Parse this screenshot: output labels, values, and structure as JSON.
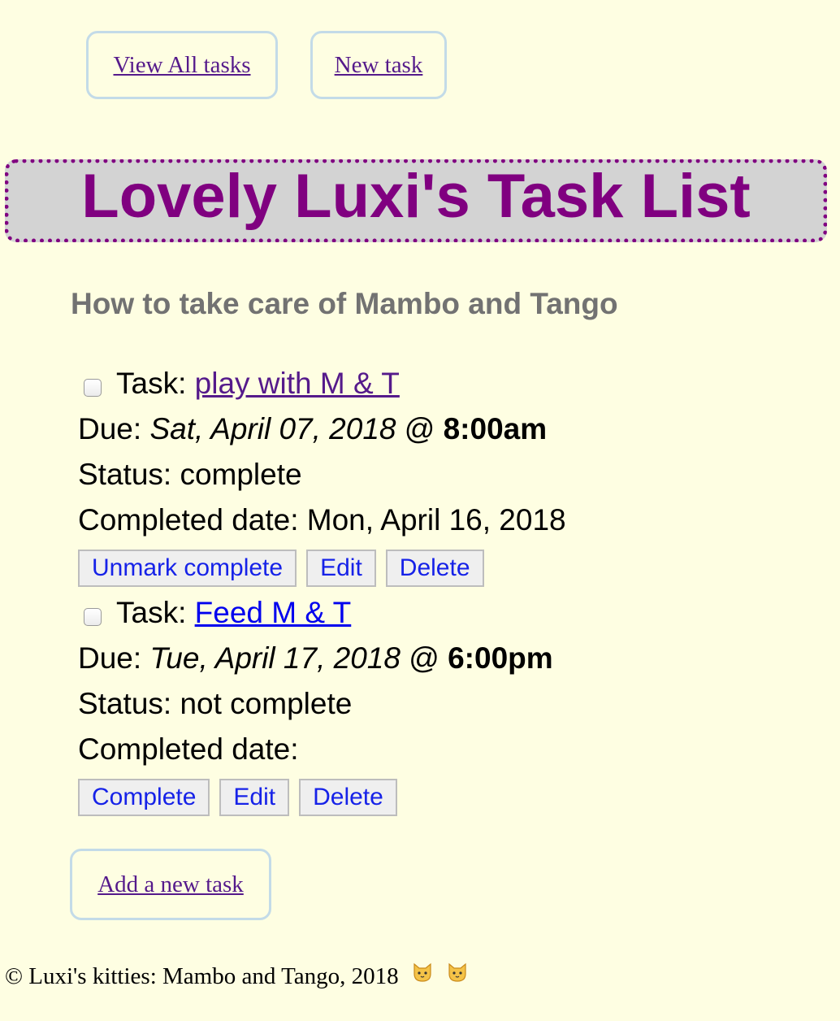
{
  "nav": {
    "view_all": "View All tasks",
    "new_task": "New task"
  },
  "title": "Lovely Luxi's Task List",
  "subtitle": "How to take care of Mambo and Tango",
  "tasks": [
    {
      "task_label": "Task:",
      "name": "play with M & T",
      "due_label": "Due:",
      "due_date": "Sat, April 07, 2018",
      "at": "@",
      "due_time": "8:00am",
      "status_text": "Status: complete",
      "completed_text": "Completed date: Mon, April 16, 2018",
      "actions": {
        "toggle": "Unmark complete",
        "edit": "Edit",
        "delete": "Delete"
      }
    },
    {
      "task_label": "Task:",
      "name": "Feed M & T",
      "due_label": "Due:",
      "due_date": "Tue, April 17, 2018",
      "at": "@",
      "due_time": "6:00pm",
      "status_text": "Status: not complete",
      "completed_text": "Completed date:",
      "actions": {
        "toggle": "Complete",
        "edit": "Edit",
        "delete": "Delete"
      }
    }
  ],
  "add_task": "Add a new task",
  "footer": {
    "text": "© Luxi's kitties: Mambo and Tango, 2018",
    "icons": [
      "cat-face-icon",
      "cat-face-icon"
    ]
  },
  "colors": {
    "background": "#fefee2",
    "title": "#800080",
    "title_bg": "#d3d3d3",
    "subtitle": "#727272",
    "visited_link": "#551a8b",
    "link": "#0000ee",
    "button_text": "#1622e8",
    "nav_border": "#c3dbe8"
  }
}
